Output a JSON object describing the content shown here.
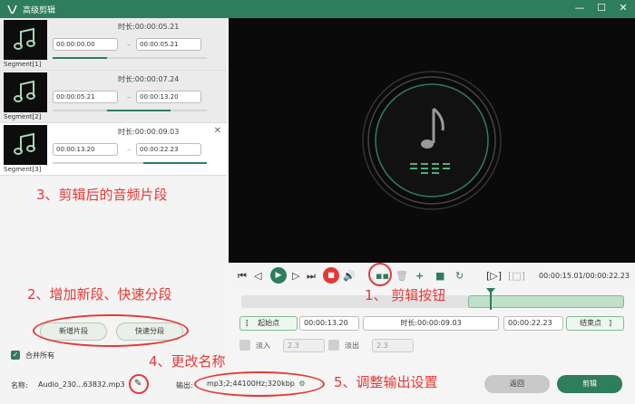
{
  "window": {
    "title": "高级剪辑"
  },
  "segments": [
    {
      "label": "Segment[1]",
      "duration": "时长:00:00:05.21",
      "start": "00:00:00.00",
      "end": "00:00:05.21"
    },
    {
      "label": "Segment[2]",
      "duration": "时长:00:00:07.24",
      "start": "00:00:05.21",
      "end": "00:00:13.20"
    },
    {
      "label": "Segment[3]",
      "duration": "时长:00:00:09.03",
      "start": "00:00:13.20",
      "end": "00:00:22.23"
    }
  ],
  "segment_progress": [
    0.35,
    0.4,
    0.42
  ],
  "buttons": {
    "add_segment": "新增片段",
    "quick_split": "快速分段",
    "back": "返回",
    "cut": "剪辑",
    "start_point": "起始点",
    "end_point": "结束点"
  },
  "merge_all": "合并所有",
  "name": {
    "label": "名称:",
    "value": "Audio_230...63832.mp3"
  },
  "output": {
    "label": "输出:",
    "value": "mp3;2;44100Hz;320kbp"
  },
  "player": {
    "time": "00:00:15.01/00:00:22.23"
  },
  "range": {
    "start": "00:00:13.20",
    "duration": "时长:00:00:09.03",
    "end": "00:00:22.23"
  },
  "fade": {
    "in_label": "淡入",
    "in_value": "2.3",
    "out_label": "淡出",
    "out_value": "2.3"
  },
  "annotations": {
    "a1": "1、 剪辑按钮",
    "a2": "2、增加新段、快速分段",
    "a3": "3、剪辑后的音频片段",
    "a4": "4、更改名称",
    "a5": "5、调整输出设置"
  },
  "colors": {
    "accent": "#2e7d5b",
    "annotation": "#e53935",
    "stop": "#e53935"
  },
  "icons": [
    "app-logo-icon",
    "music-note-icon",
    "play-icon",
    "stop-icon",
    "scissors-icon",
    "trash-icon",
    "plus-icon",
    "refresh-icon"
  ]
}
